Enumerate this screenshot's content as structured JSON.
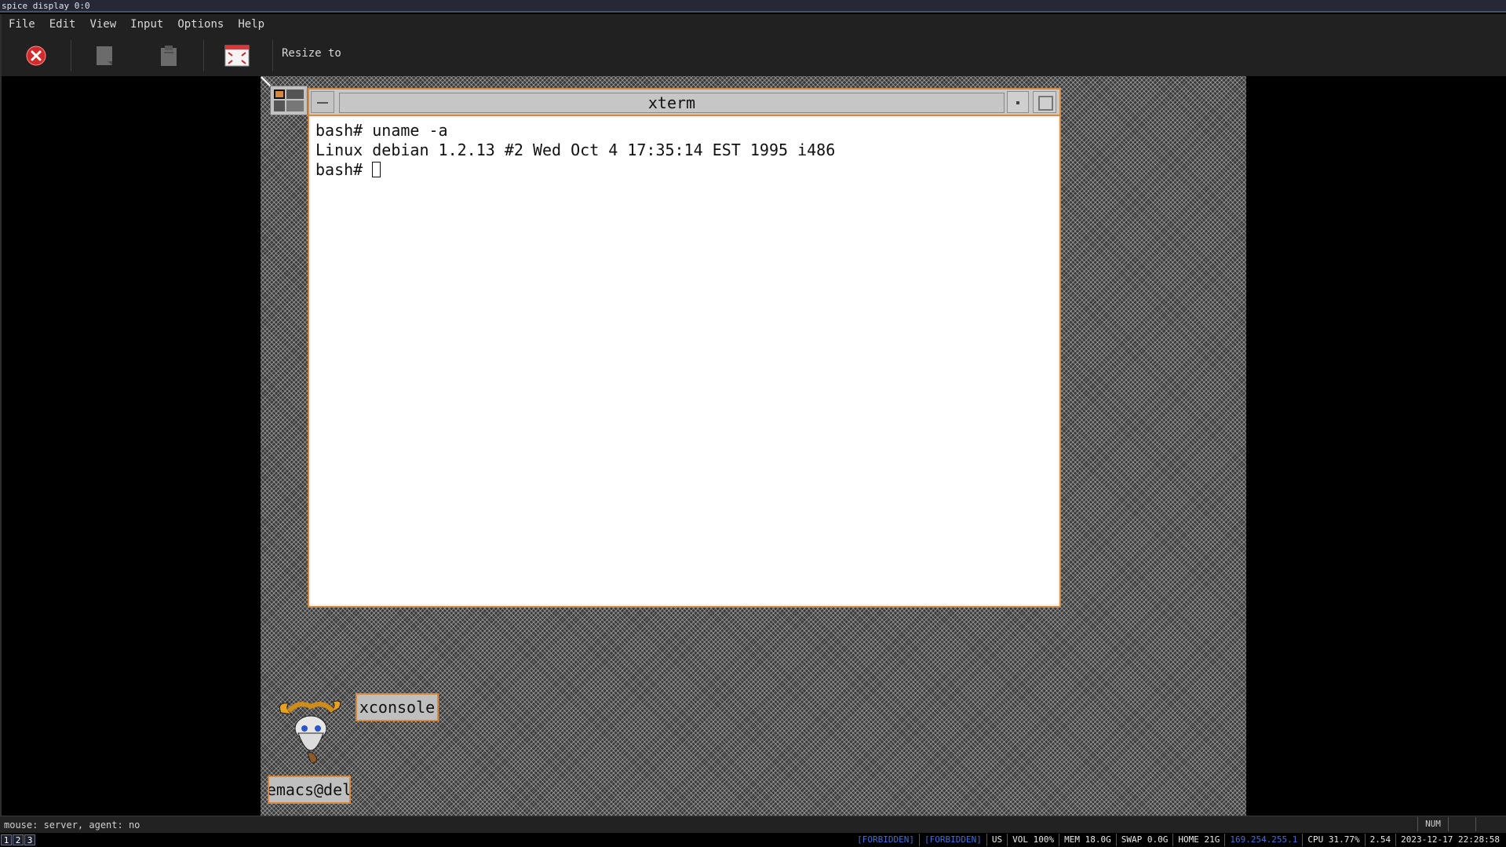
{
  "window": {
    "title": "spice display 0:0"
  },
  "menubar": {
    "items": [
      "File",
      "Edit",
      "View",
      "Input",
      "Options",
      "Help"
    ]
  },
  "toolbar": {
    "resize_label": "Resize to"
  },
  "xterm": {
    "title": "xterm",
    "lines": [
      "bash# uname -a",
      "Linux debian 1.2.13 #2 Wed Oct 4 17:35:14 EST 1995 i486",
      "bash# "
    ]
  },
  "desktop_icons": {
    "xconsole": "xconsole",
    "emacs": "emacs@del"
  },
  "statusbar": {
    "text": "mouse: server, agent:  no",
    "num": "NUM"
  },
  "bottombar": {
    "workspaces": [
      "1",
      "2",
      "3"
    ],
    "status": [
      "[FORBIDDEN]",
      "[FORBIDDEN]",
      "US",
      "VOL 100%",
      "MEM 18.0G",
      "SWAP 0.0G",
      "HOME 21G",
      "169.254.255.1",
      "CPU 31.77%",
      "2.54",
      "2023-12-17 22:28:58"
    ]
  },
  "colors": {
    "accent_border": "#d8883c",
    "desktop_bg": "#3b3b3b",
    "link_blue": "#3b6fe0"
  }
}
